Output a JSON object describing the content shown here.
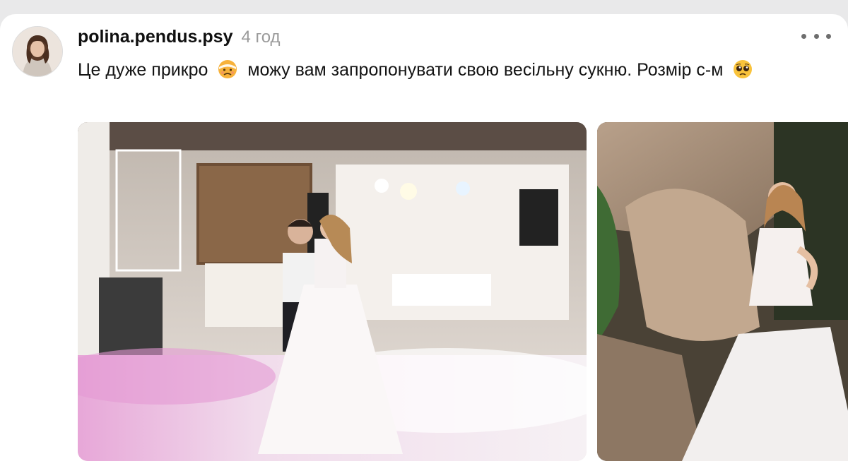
{
  "post": {
    "username": "polina.pendus.psy",
    "timestamp": "4 год",
    "text_part1": "Це дуже прикро",
    "text_part2": "можу вам запропонувати свою весільну сукню. Розмір с-м",
    "emoji_1": "face-with-head-bandage-icon",
    "emoji_2": "pleading-face-icon"
  },
  "media": [
    {
      "name": "first-dance-photo"
    },
    {
      "name": "bride-photo"
    }
  ],
  "colors": {
    "background": "#e9e9ea",
    "card": "#ffffff",
    "username": "#101010",
    "timestamp": "#9a9a9a",
    "text": "#141414"
  }
}
